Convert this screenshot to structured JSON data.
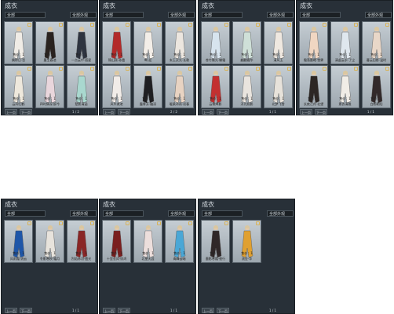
{
  "panels": [
    {
      "title": "成衣",
      "filter1": "全部",
      "filter2": "全部外观",
      "cards": [
        {
          "name": "偶得日·哲",
          "price": "售价：1"
        },
        {
          "name": "墨生春池",
          "price": "售价：1"
        },
        {
          "name": "一点云中·孤星",
          "price": "售价：1"
        },
        {
          "name": "云间归鹤",
          "price": "售价：1"
        },
        {
          "name": "四时情深·醉今",
          "price": "售价：1"
        },
        {
          "name": "楚影清涵",
          "price": "售价：1"
        }
      ],
      "prev": "上一页",
      "next": "下一页",
      "page": "1 / 2"
    },
    {
      "title": "成衣",
      "filter1": "全部",
      "filter2": "全部外观",
      "cards": [
        {
          "name": "锦山顾·赤霞",
          "price": "售价：1"
        },
        {
          "name": "喝·迎",
          "price": "售价：1"
        },
        {
          "name": "玄玉灵光·长歌",
          "price": "售价：1"
        },
        {
          "name": "风华潋滟",
          "price": "售价：1"
        },
        {
          "name": "露骨芳·幽深",
          "price": "售价：1"
        },
        {
          "name": "暖柔诗雨·初春",
          "price": "售价：1"
        }
      ],
      "prev": "上一页",
      "next": "下一页",
      "page": "2 / 2"
    },
    {
      "title": "成衣",
      "filter1": "全部",
      "filter2": "全部外观",
      "cards": [
        {
          "name": "苍竹微光·蝶霜",
          "price": "售价：1"
        },
        {
          "name": "翩翩霜华",
          "price": "售价：1"
        },
        {
          "name": "清风玉",
          "price": "售价：1"
        },
        {
          "name": "云裳绛影",
          "price": "售价：1"
        },
        {
          "name": "浮光照影",
          "price": "售价：1"
        },
        {
          "name": "北梦飞雪",
          "price": "售价：1"
        }
      ],
      "prev": "上一页",
      "next": "下一页",
      "page": "1 / 1"
    },
    {
      "title": "成衣",
      "filter1": "全部",
      "filter2": "全部外观",
      "cards": [
        {
          "name": "霜落晨曦·雪霁",
          "price": "售价：1"
        },
        {
          "name": "清虚云水·了尘",
          "price": "售价：1"
        },
        {
          "name": "暮云旧影·温时",
          "price": "售价：1"
        },
        {
          "name": "长夜江舟·北望",
          "price": "售价：1"
        },
        {
          "name": "素衣清雅",
          "price": "售价：1"
        },
        {
          "name": "白鹤朝阳",
          "price": "售价：1"
        }
      ],
      "prev": "上一页",
      "next": "下一页",
      "page": "1 / 1"
    },
    {
      "title": "成衣",
      "filter1": "全部",
      "filter2": "全部外观",
      "cards": [
        {
          "name": "风雨霜·流云",
          "price": "售价：1"
        },
        {
          "name": "冬影寒秋·霜月",
          "price": "售价：1"
        },
        {
          "name": "烈焰赤羽·霞光",
          "price": "售价：1"
        }
      ],
      "prev": "上一页",
      "next": "下一页",
      "page": "1 / 1"
    },
    {
      "title": "成衣",
      "filter1": "全部",
      "filter2": "全部外观",
      "cards": [
        {
          "name": "十里长风·惊鸿",
          "price": "售价：1"
        },
        {
          "name": "北望天涯",
          "price": "售价：1"
        },
        {
          "name": "青峰云岫",
          "price": "售价：1"
        }
      ],
      "prev": "上一页",
      "next": "下一页",
      "page": "1 / 1"
    },
    {
      "title": "成衣",
      "filter1": "全部",
      "filter2": "全部外观",
      "cards": [
        {
          "name": "墨影寒霜·夜行",
          "price": "售价：1"
        },
        {
          "name": "流金·华",
          "price": "售价：1"
        }
      ],
      "prev": "上一页",
      "next": "下一页",
      "page": "1 / 1"
    }
  ],
  "card_palette": [
    "#e8e4dc",
    "#2a2320",
    "#2e3440",
    "#b32a2a",
    "#f0ece6",
    "#e7d8c4",
    "#cfd9e0",
    "#a7d6cf",
    "#e7c9b4",
    "#d8e2ea",
    "#3b3030",
    "#e0dcd4",
    "#c83a3a",
    "#c79c6a",
    "#1e56a8",
    "#8a2626",
    "#4aa7d6",
    "#e0a030"
  ]
}
